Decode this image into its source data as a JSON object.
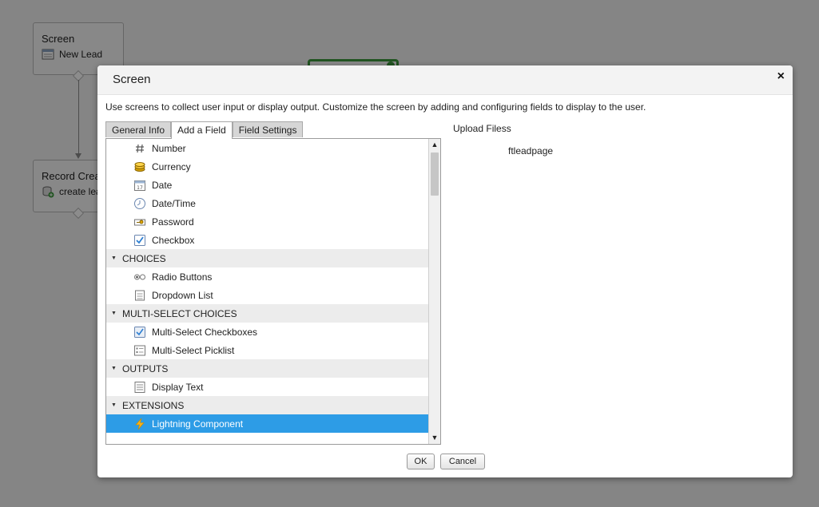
{
  "background": {
    "node1": {
      "type": "Screen",
      "name": "New Lead"
    },
    "node2": {
      "type": "Record Crea",
      "name": "create lea"
    }
  },
  "modal": {
    "title": "Screen",
    "close_label": "×",
    "description": "Use screens to collect user input or display output. Customize the screen by adding and configuring fields to display to the user.",
    "tabs": [
      {
        "label": "General Info"
      },
      {
        "label": "Add a Field"
      },
      {
        "label": "Field Settings"
      }
    ],
    "fields": {
      "top_items": [
        {
          "label": "Number",
          "icon": "hash-icon"
        },
        {
          "label": "Currency",
          "icon": "coins-icon"
        },
        {
          "label": "Date",
          "icon": "calendar-icon"
        },
        {
          "label": "Date/Time",
          "icon": "clock-icon"
        },
        {
          "label": "Password",
          "icon": "key-icon"
        },
        {
          "label": "Checkbox",
          "icon": "checkbox-icon"
        }
      ],
      "sections": [
        {
          "label": "CHOICES",
          "items": [
            {
              "label": "Radio Buttons",
              "icon": "radio-icon"
            },
            {
              "label": "Dropdown List",
              "icon": "dropdown-icon"
            }
          ]
        },
        {
          "label": "MULTI-SELECT CHOICES",
          "items": [
            {
              "label": "Multi-Select Checkboxes",
              "icon": "multi-checkbox-icon"
            },
            {
              "label": "Multi-Select Picklist",
              "icon": "picklist-icon"
            }
          ]
        },
        {
          "label": "OUTPUTS",
          "items": [
            {
              "label": "Display Text",
              "icon": "text-icon"
            }
          ]
        },
        {
          "label": "EXTENSIONS",
          "items": [
            {
              "label": "Lightning Component",
              "icon": "lightning-icon"
            }
          ]
        }
      ]
    },
    "preview": {
      "title": "Upload Filess",
      "field": "ftleadpage"
    },
    "buttons": {
      "ok": "OK",
      "cancel": "Cancel"
    }
  },
  "colors": {
    "selected": "#2d9ce6",
    "section_bg": "#ececec",
    "node_border_selected": "#3c9a3c"
  }
}
